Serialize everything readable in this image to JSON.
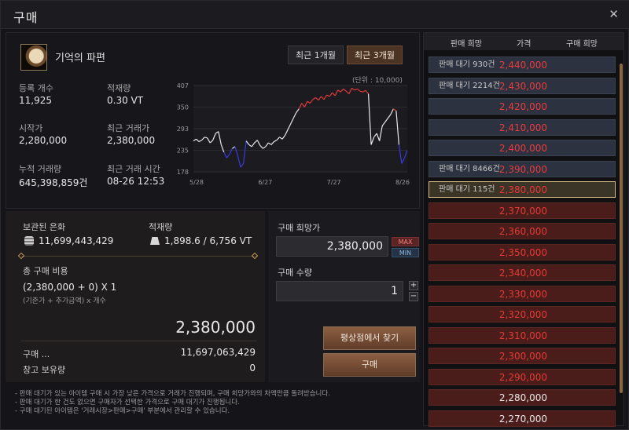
{
  "window": {
    "title": "구매"
  },
  "item": {
    "name": "기억의 파편"
  },
  "periods": [
    "최근 1개월",
    "최근 3개월"
  ],
  "unit_label": "(단위 : 10,000)",
  "stats": {
    "reg_count_label": "등록 개수",
    "reg_count": "11,925",
    "weight_label": "적재량",
    "weight": "0.30 VT",
    "start_price_label": "시작가",
    "start_price": "2,280,000",
    "recent_price_label": "최근 거래가",
    "recent_price": "2,380,000",
    "total_trades_label": "누적 거래량",
    "total_trades": "645,398,859건",
    "recent_time_label": "최근 거래 시간",
    "recent_time": "08-26 12:53"
  },
  "chart_data": {
    "type": "line",
    "x_ticks": [
      "5/28",
      "6/27",
      "7/27",
      "8/26"
    ],
    "y_ticks": [
      "407",
      "350",
      "293",
      "235",
      "178"
    ],
    "ylim": [
      178,
      407
    ],
    "y": [
      260,
      265,
      258,
      262,
      270,
      268,
      255,
      262,
      280,
      285,
      250,
      230,
      215,
      225,
      240,
      245,
      220,
      190,
      200,
      260,
      250,
      245,
      255,
      262,
      248,
      240,
      245,
      255,
      250,
      258,
      262,
      270,
      265,
      275,
      290,
      305,
      320,
      335,
      345,
      360,
      350,
      365,
      360,
      370,
      375,
      368,
      378,
      370,
      382,
      378,
      388,
      380,
      395,
      390,
      398,
      392,
      385,
      400,
      395,
      398,
      392,
      390,
      394,
      385,
      250,
      270,
      280,
      260,
      300,
      310,
      320,
      330,
      345,
      340,
      250,
      200,
      215,
      235
    ]
  },
  "wallet": {
    "silver_label": "보관된 은화",
    "silver": "11,699,443,429",
    "capacity_label": "적재량",
    "capacity": "1,898.6 / 6,756 VT",
    "cost_label": "총 구매 비용",
    "formula": "(2,380,000 + 0) X 1",
    "formula_note": "(기준가 + 추가금액) x 개수",
    "total": "2,380,000",
    "after_label": "구매 ...",
    "after": "11,697,063,429",
    "storage_label": "창고 보유량",
    "storage": "0"
  },
  "buy": {
    "price_label": "구매 희망가",
    "price": "2,380,000",
    "max": "MAX",
    "min": "MIN",
    "qty_label": "구매 수량",
    "qty": "1",
    "find_label": "평상점에서 찾기",
    "buy_label": "구매"
  },
  "notes": [
    "- 판매 대기가 있는 아이템 구매 시 가장 낮은 가격으로 거래가 진행되며, 구매 희망가와의 차액만큼 돌려받습니다.",
    "- 판매 대기가 한 건도 없으면 구매자가 선택한 가격으로 구매 대기가 진행됩니다.",
    "- 구매 대기된 아이템은 '거래시장>판매>구매' 부분에서 관리할 수 있습니다."
  ],
  "orderbook": {
    "headers": [
      "판매 희망",
      "가격",
      "구매 희망"
    ],
    "rows": [
      {
        "type": "sell",
        "label": "판매 대기 930건",
        "price": "2,440,000"
      },
      {
        "type": "sell",
        "label": "판매 대기 2214건",
        "price": "2,430,000"
      },
      {
        "type": "sell",
        "label": "",
        "price": "2,420,000"
      },
      {
        "type": "sell",
        "label": "",
        "price": "2,410,000"
      },
      {
        "type": "sell",
        "label": "",
        "price": "2,400,000"
      },
      {
        "type": "sell",
        "label": "판매 대기 8466건",
        "price": "2,390,000"
      },
      {
        "type": "sel",
        "label": "판매 대기 115건",
        "price": "2,380,000"
      },
      {
        "type": "buy",
        "label": "",
        "price": "2,370,000"
      },
      {
        "type": "buy",
        "label": "",
        "price": "2,360,000"
      },
      {
        "type": "buy",
        "label": "",
        "price": "2,350,000"
      },
      {
        "type": "buy",
        "label": "",
        "price": "2,340,000"
      },
      {
        "type": "buy",
        "label": "",
        "price": "2,330,000"
      },
      {
        "type": "buy",
        "label": "",
        "price": "2,320,000"
      },
      {
        "type": "buy",
        "label": "",
        "price": "2,310,000"
      },
      {
        "type": "buy",
        "label": "",
        "price": "2,300,000"
      },
      {
        "type": "buy",
        "label": "",
        "price": "2,290,000"
      },
      {
        "type": "buy white",
        "label": "",
        "price": "2,280,000"
      },
      {
        "type": "buy white",
        "label": "",
        "price": "2,270,000"
      }
    ]
  }
}
